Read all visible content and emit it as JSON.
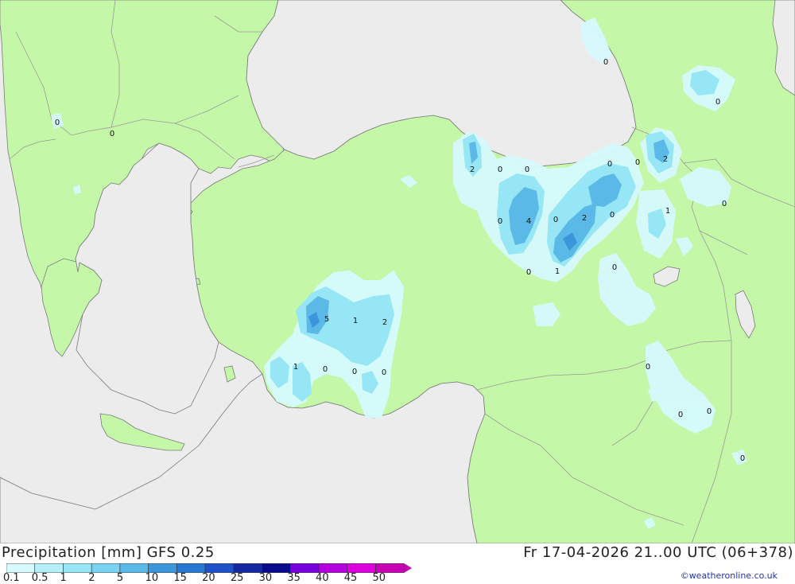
{
  "header": {
    "title_left": "Precipitation [mm] GFS 0.25",
    "title_right": "Fr 17-04-2026 21..00 UTC (06+378)"
  },
  "credit": "©weatheronline.co.uk",
  "legend": {
    "labels": [
      "0.1",
      "0.5",
      "1",
      "2",
      "5",
      "10",
      "15",
      "20",
      "25",
      "30",
      "35",
      "40",
      "45",
      "50"
    ],
    "colors": [
      "#d6fafe",
      "#b4f0fa",
      "#96e6f5",
      "#78d2f0",
      "#5ab9e6",
      "#3c96dc",
      "#2878d2",
      "#1e50c8",
      "#1428a0",
      "#0a0a8c",
      "#7800dc",
      "#b400dc",
      "#dc00dc",
      "#c800b4"
    ]
  },
  "map": {
    "colors": {
      "sea": "#ececec",
      "land": "#c4f8a8",
      "border": "#9a9a9a",
      "coast": "#7a7a7a"
    },
    "values": [
      {
        "id": "v1",
        "text": "0"
      },
      {
        "id": "v2",
        "text": "0"
      },
      {
        "id": "v3",
        "text": "0"
      },
      {
        "id": "v4",
        "text": "0"
      },
      {
        "id": "v5",
        "text": "2"
      },
      {
        "id": "v6",
        "text": "0"
      },
      {
        "id": "v7",
        "text": "0"
      },
      {
        "id": "v8",
        "text": "0"
      },
      {
        "id": "v9",
        "text": "0"
      },
      {
        "id": "v10",
        "text": "2"
      },
      {
        "id": "v11",
        "text": "0"
      },
      {
        "id": "v12",
        "text": "4"
      },
      {
        "id": "v13",
        "text": "0"
      },
      {
        "id": "v14",
        "text": "2"
      },
      {
        "id": "v15",
        "text": "0"
      },
      {
        "id": "v16",
        "text": "1"
      },
      {
        "id": "v17",
        "text": "0"
      },
      {
        "id": "v18",
        "text": "0"
      },
      {
        "id": "v19",
        "text": "1"
      },
      {
        "id": "v20",
        "text": "0"
      },
      {
        "id": "v21",
        "text": "5"
      },
      {
        "id": "v22",
        "text": "1"
      },
      {
        "id": "v23",
        "text": "2"
      },
      {
        "id": "v24",
        "text": "1"
      },
      {
        "id": "v25",
        "text": "0"
      },
      {
        "id": "v26",
        "text": "0"
      },
      {
        "id": "v27",
        "text": "0"
      },
      {
        "id": "v28",
        "text": "0"
      },
      {
        "id": "v29",
        "text": "0"
      },
      {
        "id": "v30",
        "text": "0"
      },
      {
        "id": "v31",
        "text": "0"
      }
    ]
  }
}
